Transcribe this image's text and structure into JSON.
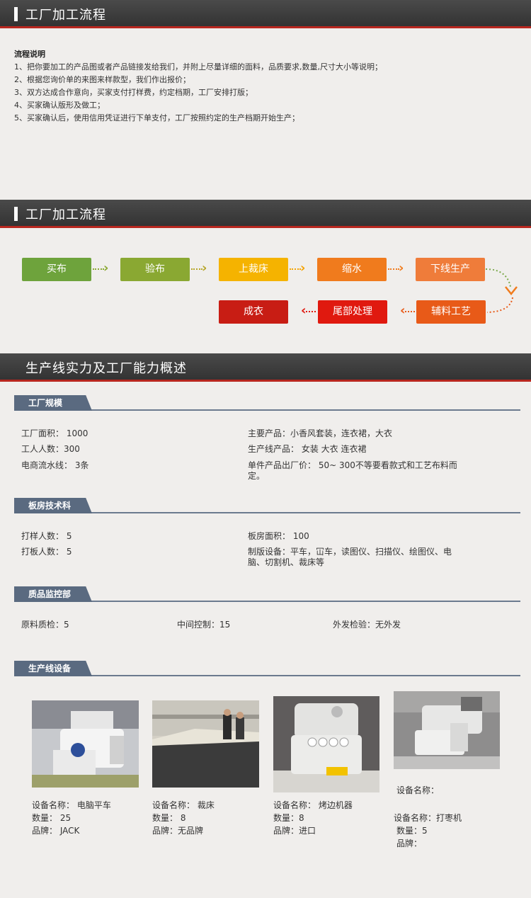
{
  "section1": {
    "title": "工厂加工流程"
  },
  "intro": {
    "heading": "流程说明",
    "lines": [
      "1、把你要加工的产品图或者产品链接发给我们，并附上尽量详细的面料，品质要求,数量,尺寸大小等说明；",
      "2、根据您询价单的来图来样款型，我们作出报价；",
      "3、双方达成合作意向，买家支付打样费，约定档期，工厂安排打版；",
      "4、买家确认版形及做工；",
      "5、买家确认后，使用信用凭证进行下单支付，工厂按照约定的生产档期开始生产；"
    ]
  },
  "section2": {
    "title": "工厂加工流程"
  },
  "flow": {
    "row1": [
      "买布",
      "验布",
      "上裁床",
      "缩水",
      "下线生产"
    ],
    "row2": [
      "成衣",
      "尾部处理",
      "辅料工艺"
    ],
    "colors": [
      "#6ea33c",
      "#8aa832",
      "#f5b300",
      "#f07b1d",
      "#ef7c3a",
      "#c81d14",
      "#e0190f",
      "#e85a18"
    ]
  },
  "section3": {
    "title": "生产线实力及工厂能力概述"
  },
  "scale": {
    "tab": "工厂规模",
    "left": [
      "工厂面积： 1000",
      "工人人数：300",
      "电商流水线： 3条"
    ],
    "right": [
      "主要产品：小香风套装，连衣裙，大衣",
      "生产线产品： 女装    大衣  连衣裙",
      "单件产品出厂价： 50~ 300不等要看款式和工艺布料而定。"
    ]
  },
  "tech": {
    "tab": "板房技术科",
    "left": [
      "打样人数： 5",
      "打板人数： 5"
    ],
    "right": [
      "板房面积： 100",
      "制版设备：平车，冚车，读图仪、扫描仪、绘图仪、电脑、切割机、裁床等"
    ]
  },
  "qc": {
    "tab": "质品监控部",
    "items": [
      "原料质检：5",
      "中间控制：15",
      "外发检验：无外发"
    ]
  },
  "equipment": {
    "tab": "生产线设备",
    "items": [
      {
        "name": "设备名称：  电脑平车",
        "qty": "数量：  25",
        "brand": "品牌：  JACK"
      },
      {
        "name": "设备名称：  裁床",
        "qty": "数量：  8",
        "brand": "品牌：无品牌"
      },
      {
        "name": "设备名称：  烤边机器",
        "qty": "数量：8",
        "brand": "品牌：进口"
      },
      {
        "name0": "设备名称：",
        "name": "设备名称：打枣机",
        "qty": "数量：5",
        "brand": "品牌："
      }
    ]
  }
}
